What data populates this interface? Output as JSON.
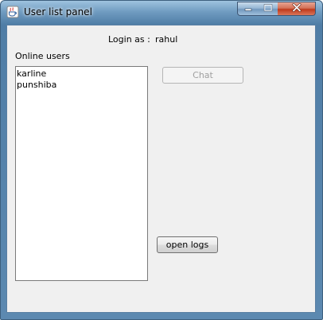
{
  "window": {
    "title": "User list panel",
    "icon": "java-cup-icon",
    "controls": {
      "minimize": "minimize-icon",
      "maximize": "maximize-icon",
      "close": "close-icon"
    }
  },
  "login": {
    "label": "Login as :",
    "username": "rahul"
  },
  "online_users": {
    "label": "Online users",
    "items": [
      "karline",
      "punshiba"
    ]
  },
  "buttons": {
    "chat": {
      "label": "Chat",
      "enabled": false
    },
    "open_logs": {
      "label": "open logs",
      "enabled": true
    }
  },
  "colors": {
    "title_bar": "#6f9bc0",
    "close_button": "#c0391b",
    "client_background": "#f0f0f0"
  }
}
